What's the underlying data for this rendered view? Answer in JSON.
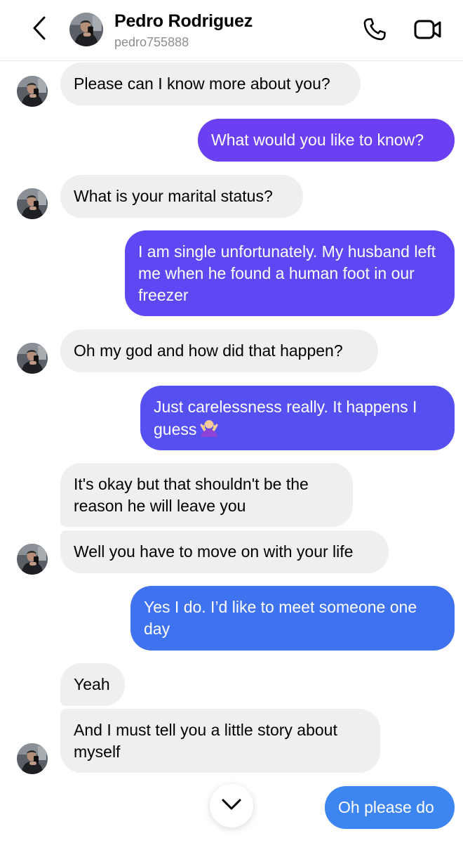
{
  "header": {
    "contact_name": "Pedro Rodriguez",
    "contact_handle": "pedro755888",
    "back_icon": "chevron-left-icon",
    "call_icon": "phone-icon",
    "video_icon": "video-camera-icon"
  },
  "colors": {
    "incoming_bubble": "#efefef",
    "outgoing_purple": "#6b3ff2",
    "outgoing_indigo": "#5a4ef2",
    "outgoing_blue": "#3f72ef",
    "outgoing_light_blue": "#3d85f0",
    "handle_gray": "#8e8e8e"
  },
  "messages": [
    {
      "direction": "in",
      "text": "Please can I know more about you?"
    },
    {
      "direction": "out",
      "text": "What would you like to know?"
    },
    {
      "direction": "in",
      "text": "What is your marital status?"
    },
    {
      "direction": "out",
      "text": "I am single unfortunately. My husband left me when he found a human foot in our freezer"
    },
    {
      "direction": "in",
      "text": "Oh my god and how did that happen?"
    },
    {
      "direction": "out",
      "text": "Just carelessness really. It happens I guess",
      "emoji": "woman-shrugging-emoji"
    },
    {
      "direction": "in",
      "text": "It's okay but that shouldn't be the reason he will leave you"
    },
    {
      "direction": "in",
      "text": "Well you have to move on with your life"
    },
    {
      "direction": "out",
      "text": "Yes I do. I’d like to meet someone one day"
    },
    {
      "direction": "in",
      "text": "Yeah"
    },
    {
      "direction": "in",
      "text": "And I must tell you a little story about myself"
    },
    {
      "direction": "out",
      "text": "Oh please do"
    }
  ],
  "scroll_button_icon": "chevron-down-icon"
}
